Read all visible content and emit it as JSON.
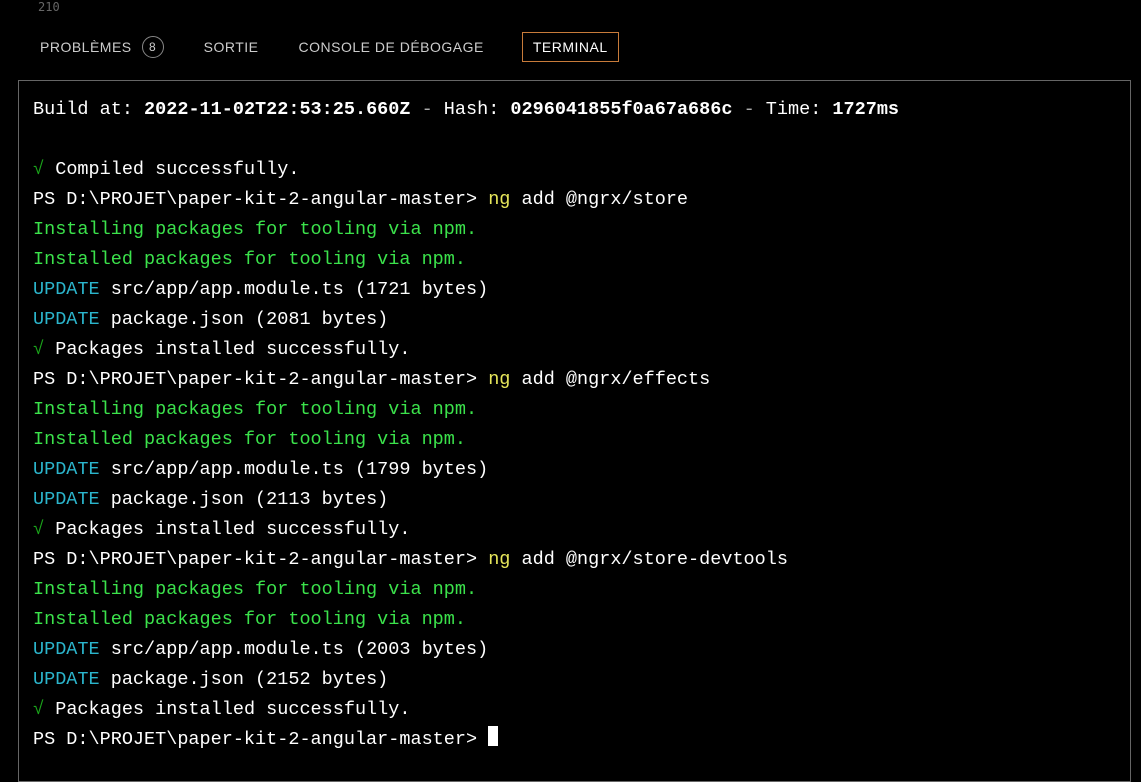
{
  "top": {
    "line_number": "210"
  },
  "tabs": {
    "problems": "PROBLÈMES",
    "problems_count": "8",
    "output": "SORTIE",
    "debug": "CONSOLE DE DÉBOGAGE",
    "terminal": "TERMINAL"
  },
  "terminal": {
    "build_prefix": "Build at: ",
    "build_time": "2022-11-02T22:53:25.660Z",
    "sep": " - ",
    "hash_label": "Hash: ",
    "hash": "0296041855f0a67a686c",
    "time_label": "Time: ",
    "time_value": "1727ms",
    "check": "√",
    "compiled": " Compiled successfully.",
    "prompt1": "PS D:\\PROJET\\paper-kit-2-angular-master> ",
    "ng": "ng",
    "cmd1": " add @ngrx/store",
    "installing": "Installing packages for tooling via npm.",
    "installed": "Installed packages for tooling via npm.",
    "update": "UPDATE",
    "upd1a": " src/app/app.module.ts (1721 bytes)",
    "upd1b": " package.json (2081 bytes)",
    "pkg_ok": " Packages installed successfully.",
    "cmd2": " add @ngrx/effects",
    "upd2a": " src/app/app.module.ts (1799 bytes)",
    "upd2b": " package.json (2113 bytes)",
    "cmd3": " add @ngrx/store-devtools",
    "upd3a": " src/app/app.module.ts (2003 bytes)",
    "upd3b": " package.json (2152 bytes)"
  }
}
